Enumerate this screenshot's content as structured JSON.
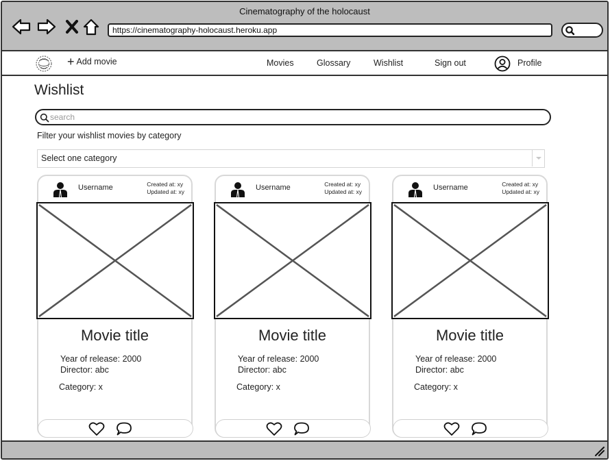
{
  "browser": {
    "window_title": "Cinematography of the holocaust",
    "url": "https://cinematography-holocaust.heroku.app"
  },
  "navbar": {
    "add_movie": "Add movie",
    "movies": "Movies",
    "glossary": "Glossary",
    "wishlist": "Wishlist",
    "sign_out": "Sign out",
    "profile": "Profile"
  },
  "page": {
    "title": "Wishlist",
    "search_placeholder": "search",
    "filter_label": "Filter your wishlist movies by category",
    "category_select": "Select one category"
  },
  "cards": [
    {
      "username": "Username",
      "created": "Created at: xy",
      "updated": "Updated at: xy",
      "title": "Movie title",
      "year": "Year of release: 2000",
      "director": "Director: abc",
      "category": "Category: x"
    },
    {
      "username": "Username",
      "created": "Created at: xy",
      "updated": "Updated at: xy",
      "title": "Movie title",
      "year": "Year of release: 2000",
      "director": "Director: abc",
      "category": "Category: x"
    },
    {
      "username": "Username",
      "created": "Created at: xy",
      "updated": "Updated at: xy",
      "title": "Movie title",
      "year": "Year of release: 2000",
      "director": "Director: abc",
      "category": "Category: x"
    }
  ],
  "icons": {
    "back": "back-arrow-icon",
    "forward": "forward-arrow-icon",
    "stop": "close-icon",
    "home": "home-icon",
    "search": "search-icon",
    "logo": "logo-icon",
    "add": "plus-icon",
    "profile": "profile-icon",
    "user": "user-icon",
    "image_placeholder": "image-placeholder-icon",
    "like": "heart-icon",
    "comment": "comment-icon",
    "resize": "resize-grip-icon"
  },
  "colors": {
    "chrome": "#bdbdbd",
    "border": "#333333",
    "card_border": "#d8d8d8",
    "placeholder_x": "#555555"
  }
}
